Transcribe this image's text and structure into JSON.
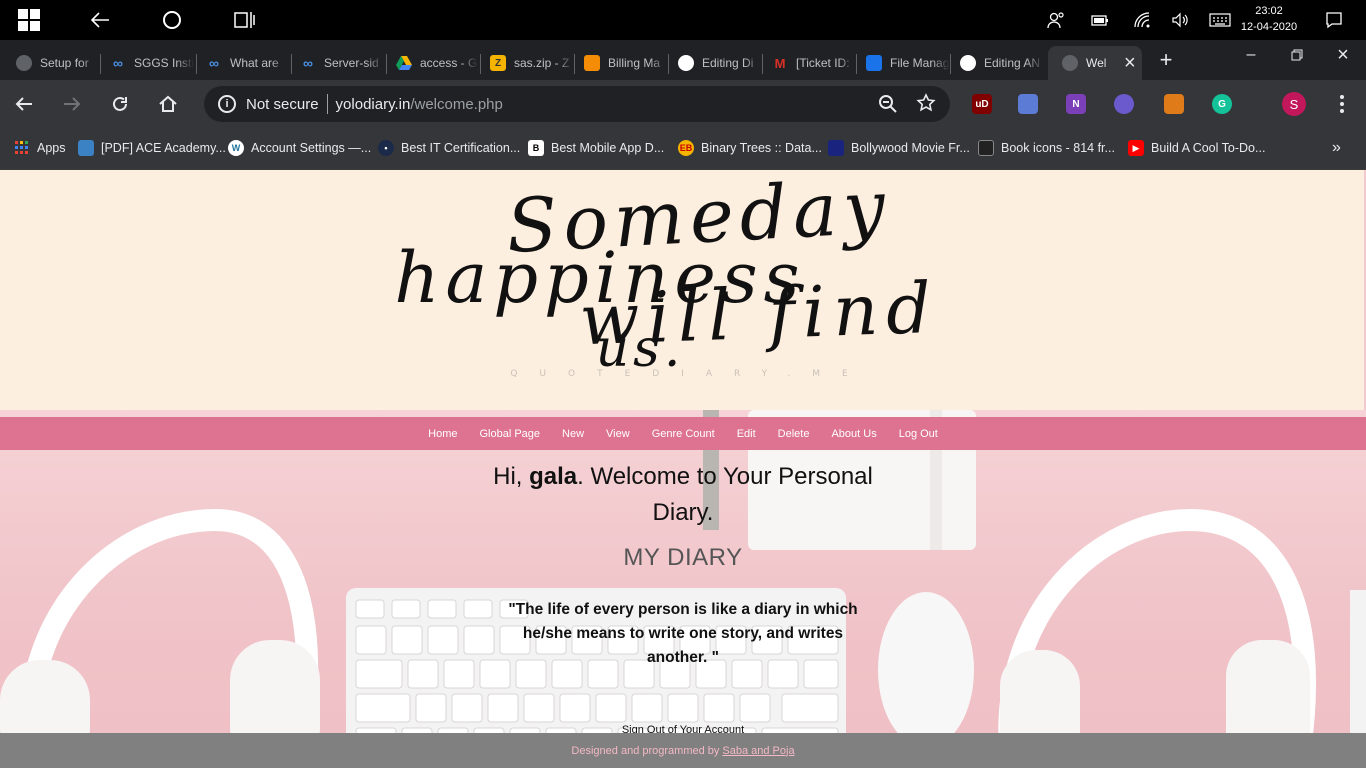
{
  "taskbar": {
    "time": "23:02",
    "date": "12-04-2020"
  },
  "tabs": [
    {
      "label": "Setup for",
      "icon": "globe-icon",
      "color": "#9aa0a6"
    },
    {
      "label": "SGGS Insti",
      "icon": "infinity-icon",
      "color": "#4a90e2"
    },
    {
      "label": "What are",
      "icon": "infinity-icon",
      "color": "#4a90e2"
    },
    {
      "label": "Server-sid",
      "icon": "infinity-icon",
      "color": "#4a90e2"
    },
    {
      "label": "access - G",
      "icon": "drive-icon",
      "color": "#34a853"
    },
    {
      "label": "sas.zip - Z",
      "icon": "zip-icon",
      "color": "#f4b400"
    },
    {
      "label": "Billing Ma",
      "icon": "aws-icon",
      "color": "#f48c06"
    },
    {
      "label": "Editing Di",
      "icon": "github-icon",
      "color": "#ffffff"
    },
    {
      "label": "[Ticket ID:",
      "icon": "gmail-icon",
      "color": "#d93025"
    },
    {
      "label": "File Manag",
      "icon": "file-manager-icon",
      "color": "#1a73e8"
    },
    {
      "label": "Editing AN",
      "icon": "github-icon",
      "color": "#ffffff"
    },
    {
      "label": "Wel",
      "icon": "globe-icon",
      "color": "#9aa0a6"
    }
  ],
  "omnibox": {
    "security": "Not secure",
    "host": "yolodiary.in",
    "path": "/welcome.php"
  },
  "profile_initial": "S",
  "bookmarks": [
    {
      "label": "Apps"
    },
    {
      "label": "[PDF] ACE Academy..."
    },
    {
      "label": "Account Settings —..."
    },
    {
      "label": "Best IT Certification..."
    },
    {
      "label": "Best Mobile App D..."
    },
    {
      "label": "Binary Trees :: Data..."
    },
    {
      "label": "Bollywood Movie Fr..."
    },
    {
      "label": "Book icons - 814 fr..."
    },
    {
      "label": "Build A Cool To-Do..."
    }
  ],
  "banner": {
    "line1": "Someday",
    "line2": "happiness",
    "line3": "will find",
    "line4": "us.",
    "watermark": "QUOTEDIARY.ME"
  },
  "nav": {
    "items": [
      "Home",
      "Global Page",
      "New",
      "View",
      "Genre Count",
      "Edit",
      "Delete",
      "About Us",
      "Log Out"
    ]
  },
  "welcome": {
    "greeting": "Hi, ",
    "username": "gala",
    "rest": ". Welcome to Your Personal Diary."
  },
  "diary_title": "MY DIARY",
  "quote": "\"The life of every person is like a diary in which he/she means to write one story, and writes another. \"",
  "signout": "Sign Out of Your Account",
  "footer": {
    "text": "Designed and programmed by",
    "link": "Saba and Poja"
  },
  "colors": {
    "nav_bg": "#de7391",
    "banner_bg": "#fdefe0",
    "footer_bg": "#808080",
    "footer_text": "#f4b8c6"
  }
}
